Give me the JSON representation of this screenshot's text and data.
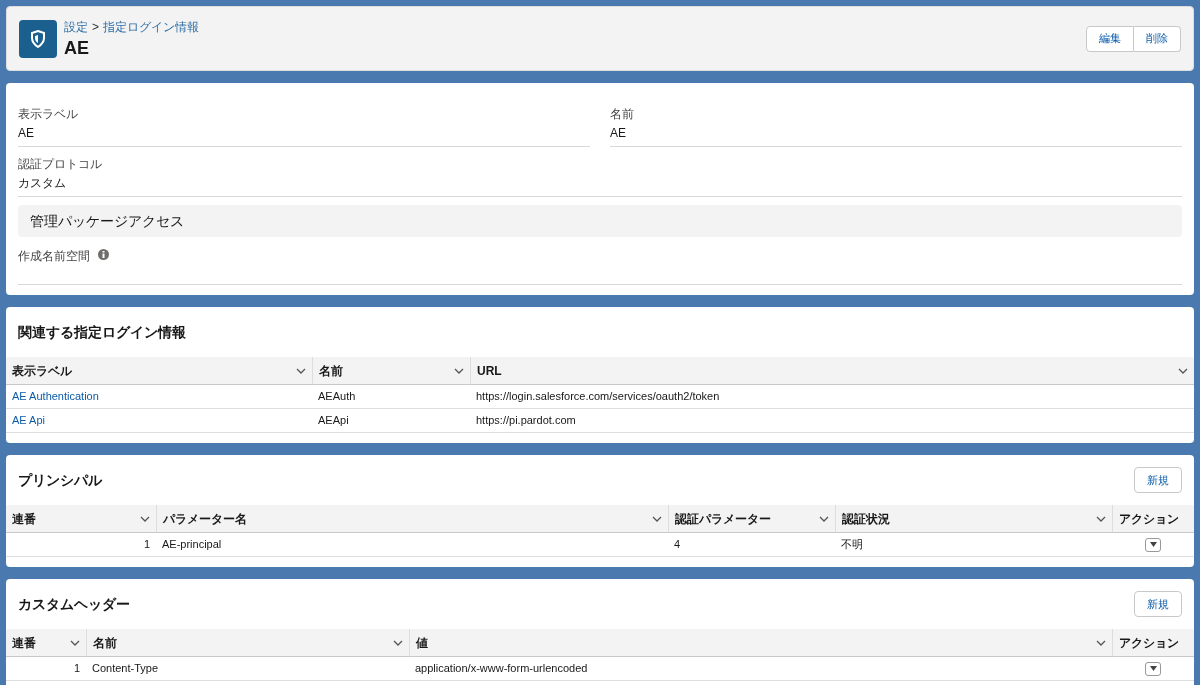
{
  "header": {
    "breadcrumb": [
      {
        "label": "設定"
      },
      {
        "label": "指定ログイン情報"
      }
    ],
    "breadcrumb_separator": ">",
    "title": "AE",
    "buttons": [
      {
        "label": "編集"
      },
      {
        "label": "削除"
      }
    ]
  },
  "details": {
    "fields": [
      {
        "label": "表示ラベル",
        "value": "AE"
      },
      {
        "label": "名前",
        "value": "AE"
      },
      {
        "label": "認証プロトコル",
        "value": "カスタム"
      }
    ],
    "section_title": "管理パッケージアクセス",
    "namespace_field": {
      "label": "作成名前空間"
    }
  },
  "sections": [
    {
      "title": "関連する指定ログイン情報",
      "columns": [
        {
          "label": "表示ラベル",
          "kind": "link",
          "sortable": true
        },
        {
          "label": "名前",
          "kind": "text",
          "sortable": true
        },
        {
          "label": "URL",
          "kind": "text",
          "sortable": true
        }
      ],
      "rows": [
        {
          "cells": [
            "AE Authentication",
            "AEAuth",
            "https://login.salesforce.com/services/oauth2/token"
          ]
        },
        {
          "cells": [
            "AE Api",
            "AEApi",
            "https://pi.pardot.com"
          ]
        }
      ]
    },
    {
      "title": "プリンシパル",
      "new_button": "新規",
      "columns": [
        {
          "label": "連番",
          "kind": "number",
          "sortable": true
        },
        {
          "label": "パラメーター名",
          "kind": "text",
          "sortable": true
        },
        {
          "label": "認証パラメーター",
          "kind": "text",
          "sortable": true
        },
        {
          "label": "認証状況",
          "kind": "text",
          "sortable": true
        },
        {
          "label": "アクション",
          "kind": "action",
          "sortable": false
        }
      ],
      "rows": [
        {
          "cells": [
            "1",
            "AE-principal",
            "4",
            "不明"
          ]
        }
      ]
    },
    {
      "title": "カスタムヘッダー",
      "new_button": "新規",
      "columns": [
        {
          "label": "連番",
          "kind": "number",
          "sortable": true
        },
        {
          "label": "名前",
          "kind": "text",
          "sortable": true
        },
        {
          "label": "値",
          "kind": "text",
          "sortable": true
        },
        {
          "label": "アクション",
          "kind": "action",
          "sortable": false
        }
      ],
      "rows": [
        {
          "cells": [
            "1",
            "Content-Type",
            "application/x-www-form-urlencoded"
          ]
        }
      ]
    }
  ]
}
